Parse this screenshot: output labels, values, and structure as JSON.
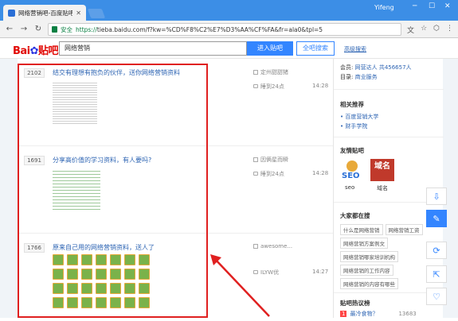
{
  "browser": {
    "tab_title": "网络营销吧-百度贴吧",
    "user": "Yifeng",
    "url_secure_label": "安全",
    "url_prefix": "https://",
    "url_rest": "tieba.baidu.com/f?kw=%CD%F8%C2%E7%D3%AA%CF%FA&fr=ala0&tpl=5"
  },
  "header": {
    "logo_text": "Bai",
    "logo_text2": "贴吧",
    "search_value": "网络营销",
    "enter_button": "进入贴吧",
    "all_search_button": "全吧搜索",
    "advanced_search": "高级搜索"
  },
  "posts": [
    {
      "replies": "2102",
      "title": "结交有理想有抱负的伙伴，送你网络营销资料",
      "author": "定州甜甜猪",
      "last_reply": "睡到24点",
      "time": "14:28"
    },
    {
      "replies": "1691",
      "title": "分享高价值的学习资料，有人要吗?",
      "author": "因俩星而瞬",
      "last_reply": "睡到24点",
      "time": "14:28"
    },
    {
      "replies": "1766",
      "title": "原来自己用的网络营销资料，送人了",
      "author": "awesome...",
      "last_reply": "ILYW优",
      "time": "14:27"
    }
  ],
  "sidebar": {
    "member_label": "会员:",
    "member_value": "网营达人 共456657人",
    "dir_label": "目录:",
    "dir_value": "商业服务",
    "related_title": "相关推荐",
    "related_items": [
      "百度营销大学",
      "财手学院"
    ],
    "friends_title": "友情贴吧",
    "friend1": "seo",
    "friend2": "域名",
    "friend2_logo": "域名",
    "hot_title": "大家都在搜",
    "hot_chips": [
      "什么是网络营销",
      "网络营销工资",
      "网络营销方案例文",
      "网络营销哪家培训机构",
      "网络营销的工作内容",
      "网络营销的内容有哪些"
    ],
    "rank_title": "贴吧热议榜",
    "rank_num": "1",
    "rank_item": "最冷食物？",
    "rank_count": "13683"
  },
  "float_icons": [
    "download-icon",
    "edit-icon",
    "refresh-icon",
    "share-icon",
    "heart-icon"
  ],
  "colors": {
    "brand_red": "#e10602",
    "brand_blue": "#2932e1",
    "primary": "#3385ff",
    "link": "#2d64b3",
    "annotation_red": "#e02020"
  }
}
